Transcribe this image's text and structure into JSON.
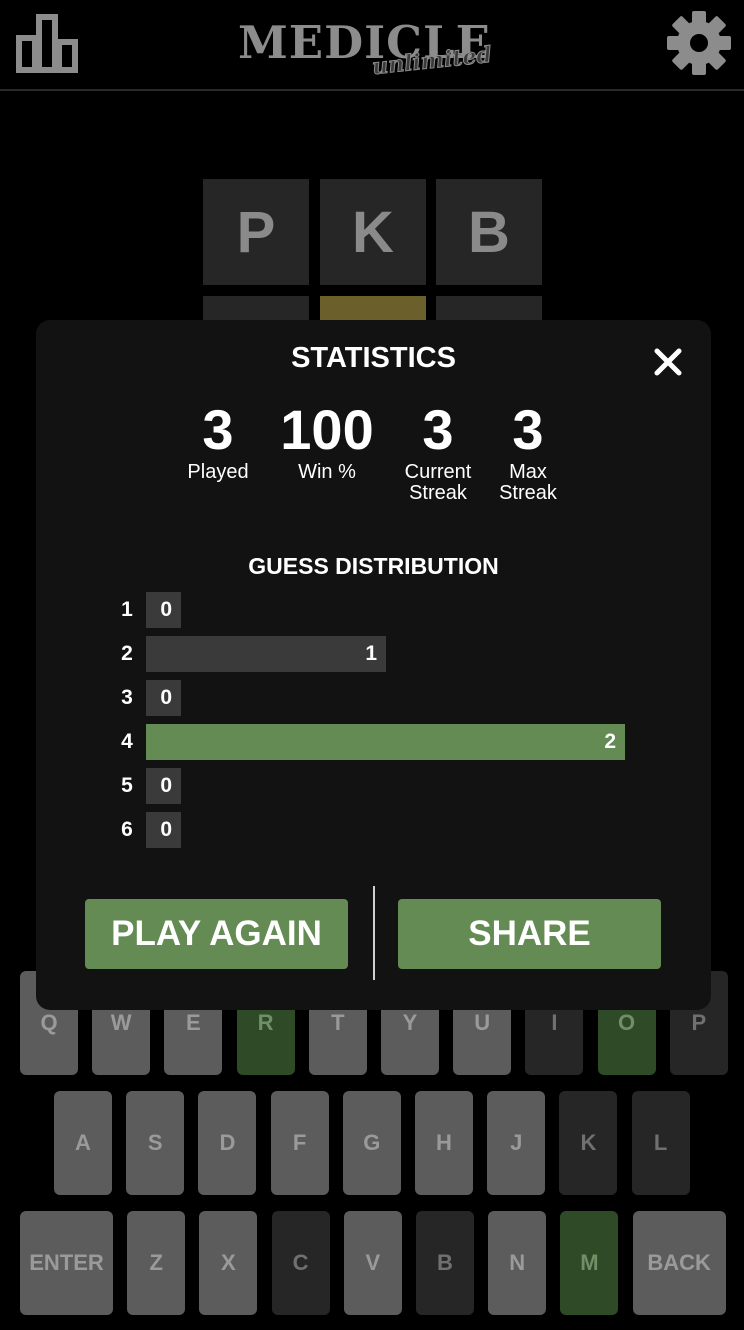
{
  "header": {
    "logo_main": "MEDICLE",
    "logo_sub": "unlimited",
    "stats_icon": "bar-chart-icon",
    "settings_icon": "gear-icon"
  },
  "board": {
    "rows": [
      [
        {
          "letter": "P",
          "state": "empty"
        },
        {
          "letter": "K",
          "state": "empty"
        },
        {
          "letter": "B",
          "state": "empty"
        }
      ],
      [
        {
          "letter": "",
          "state": "empty"
        },
        {
          "letter": "",
          "state": "present"
        },
        {
          "letter": "",
          "state": "empty"
        }
      ]
    ]
  },
  "modal": {
    "title": "STATISTICS",
    "close_icon": "close-icon",
    "stats": [
      {
        "value": "3",
        "label": "Played"
      },
      {
        "value": "100",
        "label": "Win %"
      },
      {
        "value": "3",
        "label": "Current Streak"
      },
      {
        "value": "3",
        "label": "Max Streak"
      }
    ],
    "distribution_title": "GUESS DISTRIBUTION",
    "distribution": [
      {
        "guess": "1",
        "count": 0
      },
      {
        "guess": "2",
        "count": 1
      },
      {
        "guess": "3",
        "count": 0
      },
      {
        "guess": "4",
        "count": 2,
        "highlight": true
      },
      {
        "guess": "5",
        "count": 0
      },
      {
        "guess": "6",
        "count": 0
      }
    ],
    "play_again_label": "PLAY AGAIN",
    "share_label": "SHARE"
  },
  "keyboard": {
    "rows": [
      [
        {
          "label": "Q",
          "state": "unused"
        },
        {
          "label": "W",
          "state": "unused"
        },
        {
          "label": "E",
          "state": "unused"
        },
        {
          "label": "R",
          "state": "correct"
        },
        {
          "label": "T",
          "state": "unused"
        },
        {
          "label": "Y",
          "state": "unused"
        },
        {
          "label": "U",
          "state": "unused"
        },
        {
          "label": "I",
          "state": "absent"
        },
        {
          "label": "O",
          "state": "correct"
        },
        {
          "label": "P",
          "state": "absent"
        }
      ],
      [
        {
          "label": "A",
          "state": "unused"
        },
        {
          "label": "S",
          "state": "unused"
        },
        {
          "label": "D",
          "state": "unused"
        },
        {
          "label": "F",
          "state": "unused"
        },
        {
          "label": "G",
          "state": "unused"
        },
        {
          "label": "H",
          "state": "unused"
        },
        {
          "label": "J",
          "state": "unused"
        },
        {
          "label": "K",
          "state": "absent"
        },
        {
          "label": "L",
          "state": "absent"
        }
      ],
      [
        {
          "label": "ENTER",
          "state": "unused",
          "wide": true
        },
        {
          "label": "Z",
          "state": "unused"
        },
        {
          "label": "X",
          "state": "unused"
        },
        {
          "label": "C",
          "state": "absent"
        },
        {
          "label": "V",
          "state": "unused"
        },
        {
          "label": "B",
          "state": "absent"
        },
        {
          "label": "N",
          "state": "unused"
        },
        {
          "label": "M",
          "state": "correct"
        },
        {
          "label": "BACK",
          "state": "unused",
          "wide": true
        }
      ]
    ]
  },
  "colors": {
    "correct": "#638b53",
    "present": "#6b5f2c",
    "tile": "#262626",
    "modal_bg": "#121212"
  }
}
